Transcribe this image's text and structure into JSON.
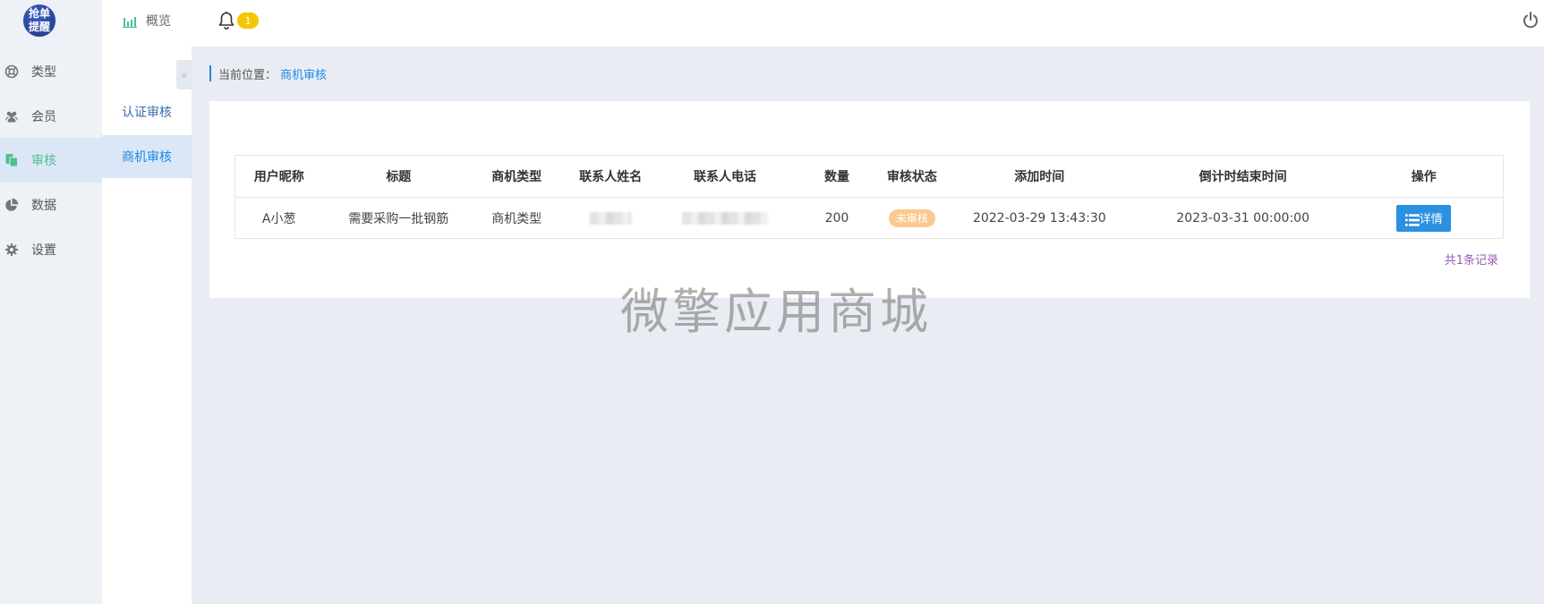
{
  "logo": {
    "line1": "抢单",
    "line2": "提醒"
  },
  "nav": {
    "items": [
      {
        "label": "类型",
        "icon": "lifebuoy-icon"
      },
      {
        "label": "会员",
        "icon": "users-icon"
      },
      {
        "label": "审核",
        "icon": "document-icon",
        "active": true
      },
      {
        "label": "数据",
        "icon": "pie-chart-icon"
      },
      {
        "label": "设置",
        "icon": "gear-icon"
      }
    ]
  },
  "subnav": {
    "items": [
      {
        "label": "认证审核"
      },
      {
        "label": "商机审核",
        "active": true
      }
    ],
    "collapse_glyph": "«"
  },
  "topbar": {
    "overview_label": "概览",
    "notification_count": "1"
  },
  "breadcrumb": {
    "prefix": "当前位置：",
    "current": "商机审核"
  },
  "table": {
    "headers": [
      "用户昵称",
      "标题",
      "商机类型",
      "联系人姓名",
      "联系人电话",
      "数量",
      "审核状态",
      "添加时间",
      "倒计时结束时间",
      "操作"
    ],
    "rows": [
      {
        "nickname": "A小葱",
        "title": "需要采购一批钢筋",
        "type": "商机类型",
        "contact_name": "",
        "contact_phone": "",
        "quantity": "200",
        "status": "未审核",
        "added_time": "2022-03-29 13:43:30",
        "deadline": "2023-03-31 00:00:00",
        "action_label": "详情"
      }
    ]
  },
  "record_count": "共1条记录",
  "watermark": "微擎应用商城",
  "colors": {
    "accent": "#1e88e5",
    "active_nav_text": "#4fc08d",
    "badge_yellow": "#f7c500",
    "status_pending": "#fcc98e",
    "button_blue": "#2a90e0",
    "record_purple": "#9b59b6"
  }
}
